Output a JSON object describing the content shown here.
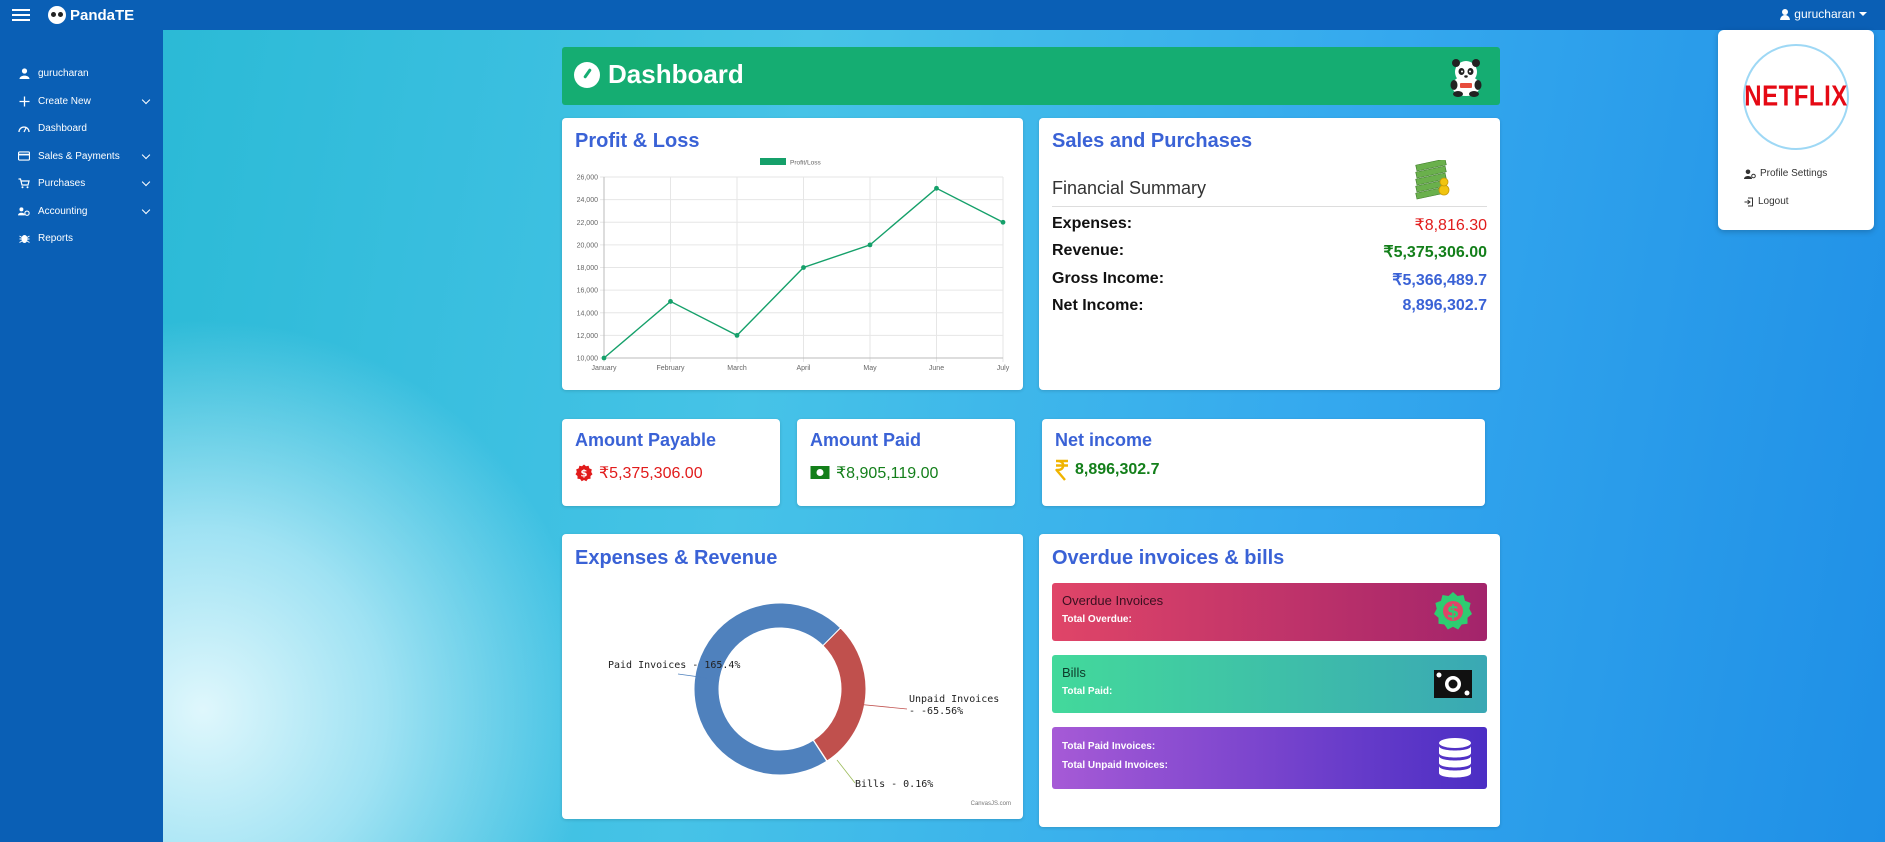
{
  "app": {
    "brand": "PandaTE",
    "user": "gurucharan"
  },
  "sidebar": {
    "items": [
      {
        "label": "gurucharan",
        "icon": "user-icon",
        "has_children": false
      },
      {
        "label": "Create New",
        "icon": "plus-icon",
        "has_children": true
      },
      {
        "label": "Dashboard",
        "icon": "dashboard-gauge-icon",
        "has_children": false
      },
      {
        "label": "Sales & Payments",
        "icon": "credit-card-icon",
        "has_children": true
      },
      {
        "label": "Purchases",
        "icon": "cart-icon",
        "has_children": true
      },
      {
        "label": "Accounting",
        "icon": "users-cog-icon",
        "has_children": true
      },
      {
        "label": "Reports",
        "icon": "bug-icon",
        "has_children": false
      }
    ]
  },
  "header": {
    "title": "Dashboard"
  },
  "profit_loss": {
    "title": "Profit & Loss",
    "chart_data": {
      "type": "line",
      "categories": [
        "January",
        "February",
        "March",
        "April",
        "May",
        "June",
        "July"
      ],
      "series": [
        {
          "name": "Profit/Loss",
          "values": [
            10000,
            15000,
            12000,
            18000,
            20000,
            25000,
            22000
          ]
        }
      ],
      "ylim": [
        10000,
        26000
      ],
      "yticks": [
        "10,000",
        "12,000",
        "14,000",
        "16,000",
        "18,000",
        "20,000",
        "22,000",
        "24,000",
        "26,000"
      ],
      "legend": "top",
      "grid": true,
      "color": "#15a06a"
    }
  },
  "sales_purchases": {
    "title": "Sales and Purchases",
    "subtitle": "Financial Summary",
    "rows": [
      {
        "label": "Expenses:",
        "value": "₹8,816.30"
      },
      {
        "label": "Revenue:",
        "value": "₹5,375,306.00"
      },
      {
        "label": "Gross Income:",
        "value": "₹5,366,489.7"
      },
      {
        "label": "Net Income:",
        "value": "8,896,302.7"
      }
    ]
  },
  "amount_payable": {
    "title": "Amount Payable",
    "value": "₹5,375,306.00"
  },
  "amount_paid": {
    "title": "Amount Paid",
    "value": "₹8,905,119.00"
  },
  "net_income": {
    "title": "Net income",
    "value": "8,896,302.7"
  },
  "expenses_revenue": {
    "title": "Expenses & Revenue",
    "credit": "CanvasJS.com",
    "chart_data": {
      "type": "pie",
      "labels": [
        "Paid Invoices",
        "Unpaid Invoices",
        "Bills"
      ],
      "values": [
        165.4,
        -65.56,
        0.16
      ],
      "label_text": [
        "Paid Invoices - 165.4%",
        "Unpaid Invoices - -65.56%",
        "Bills - 0.16%"
      ],
      "colors": [
        "#4f81bd",
        "#c0504d",
        "#9bbb59"
      ]
    }
  },
  "overdue": {
    "title": "Overdue invoices & bills",
    "cards": [
      {
        "heading": "Overdue Invoices",
        "lines": [
          "Total Overdue:"
        ],
        "icon": "dollar-badge-icon"
      },
      {
        "heading": "Bills",
        "lines": [
          "Total Paid:"
        ],
        "icon": "money-bill-icon"
      },
      {
        "heading": "",
        "lines": [
          "Total Paid Invoices:",
          "Total Unpaid Invoices:"
        ],
        "icon": "database-icon"
      }
    ]
  },
  "dropdown": {
    "avatar_text": "NETFLIX",
    "items": [
      {
        "label": "Profile Settings",
        "icon": "user-cog-icon"
      },
      {
        "label": "Logout",
        "icon": "logout-icon"
      }
    ]
  }
}
